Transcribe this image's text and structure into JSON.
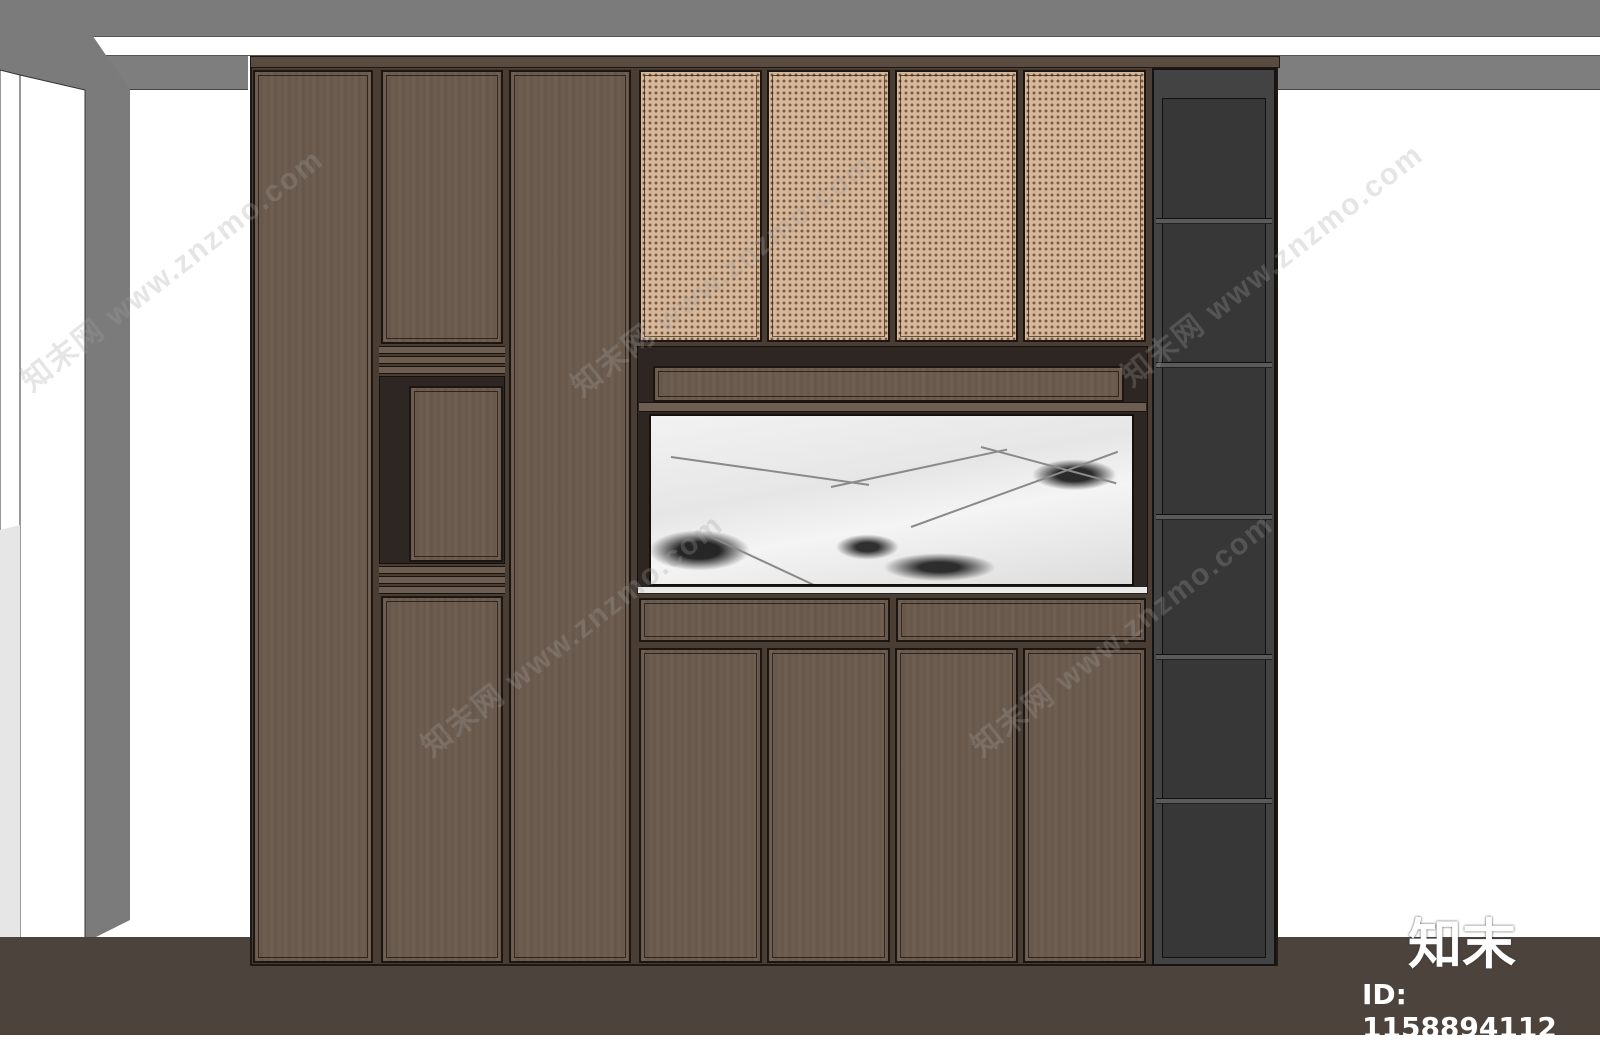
{
  "watermark": {
    "text": "知末网 www.znzmo.com"
  },
  "brand": {
    "logo_text": "知末",
    "id_text": "ID: 1158894112"
  },
  "colors": {
    "wood": "#6a5a4e",
    "rattan": "#d6b79a",
    "dark_shelf": "#434343",
    "floor": "#4d433d",
    "ceiling": "#7b7b7b"
  }
}
